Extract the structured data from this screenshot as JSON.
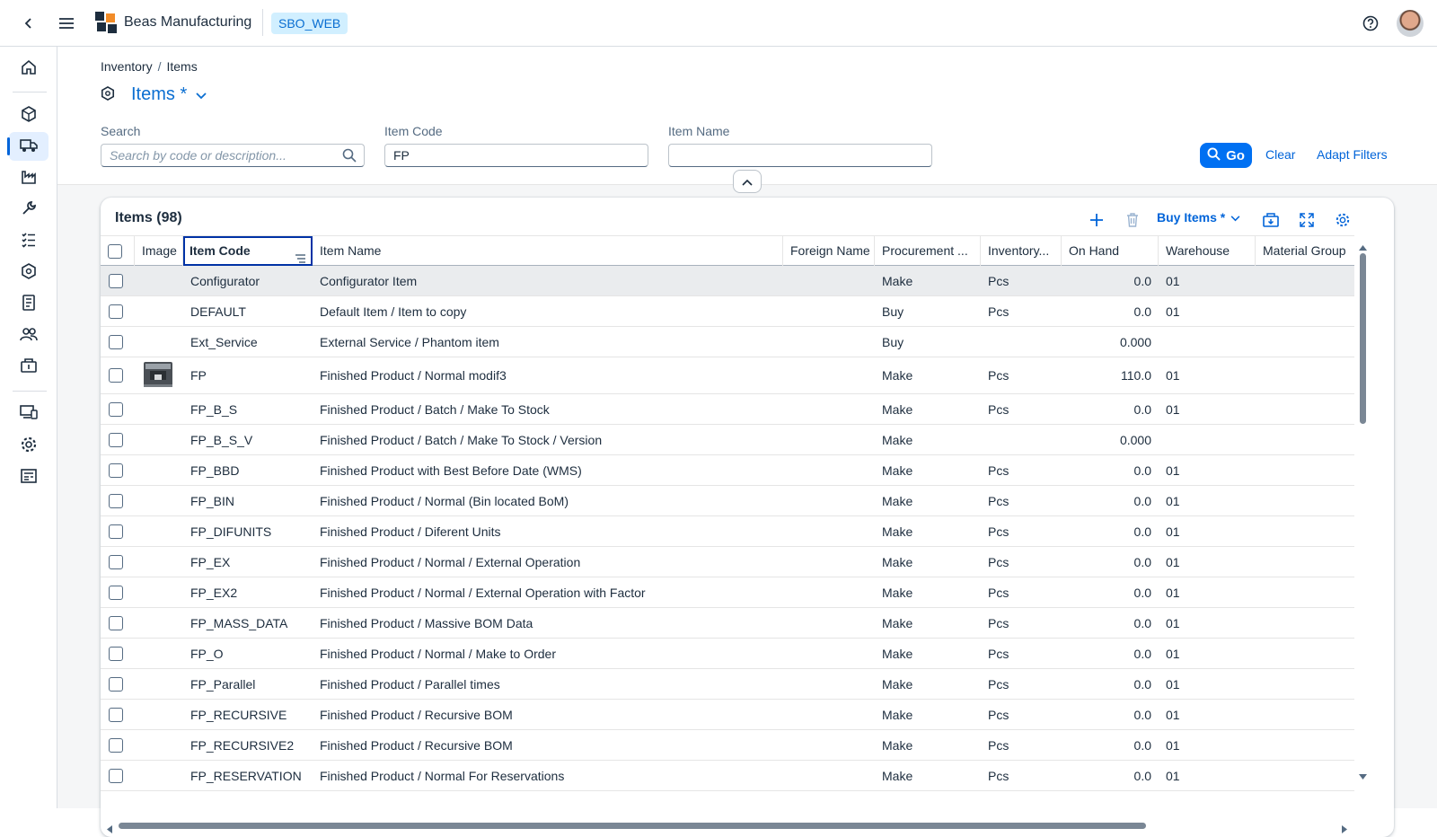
{
  "shell": {
    "app_name": "Beas Manufacturing",
    "system_tag": "SBO_WEB"
  },
  "breadcrumb": {
    "items": [
      "Inventory",
      "Items"
    ],
    "separator": "/"
  },
  "page": {
    "title": "Items *"
  },
  "filters": {
    "search": {
      "label": "Search",
      "value": "",
      "placeholder": "Search by code or description..."
    },
    "item_code": {
      "label": "Item Code",
      "value": "FP"
    },
    "item_name": {
      "label": "Item Name",
      "value": ""
    },
    "go_label": "Go",
    "clear_label": "Clear",
    "adapt_label": "Adapt Filters"
  },
  "table": {
    "title": "Items (98)",
    "variant": "Buy Items *",
    "columns": [
      "Image",
      "Item Code",
      "Item Name",
      "Foreign Name",
      "Procurement ...",
      "Inventory...",
      "On Hand",
      "Warehouse",
      "Material Group"
    ],
    "rows": [
      {
        "code": "Configurator",
        "name": "Configurator Item",
        "foreign": "",
        "proc": "Make",
        "inv": "Pcs",
        "onhand": "0.0",
        "wh": "01",
        "mg": "",
        "image": false
      },
      {
        "code": "DEFAULT",
        "name": "Default Item / Item to copy",
        "foreign": "",
        "proc": "Buy",
        "inv": "Pcs",
        "onhand": "0.0",
        "wh": "01",
        "mg": "",
        "image": false
      },
      {
        "code": "Ext_Service",
        "name": "External Service / Phantom item",
        "foreign": "",
        "proc": "Buy",
        "inv": "",
        "onhand": "0.000",
        "wh": "",
        "mg": "",
        "image": false
      },
      {
        "code": "FP",
        "name": "Finished Product / Normal modif3",
        "foreign": "",
        "proc": "Make",
        "inv": "Pcs",
        "onhand": "110.0",
        "wh": "01",
        "mg": "",
        "image": true
      },
      {
        "code": "FP_B_S",
        "name": "Finished Product / Batch / Make To Stock",
        "foreign": "",
        "proc": "Make",
        "inv": "Pcs",
        "onhand": "0.0",
        "wh": "01",
        "mg": "",
        "image": false
      },
      {
        "code": "FP_B_S_V",
        "name": "Finished Product / Batch / Make To Stock / Version",
        "foreign": "",
        "proc": "Make",
        "inv": "",
        "onhand": "0.000",
        "wh": "",
        "mg": "",
        "image": false
      },
      {
        "code": "FP_BBD",
        "name": "Finished Product with Best Before Date (WMS)",
        "foreign": "",
        "proc": "Make",
        "inv": "Pcs",
        "onhand": "0.0",
        "wh": "01",
        "mg": "",
        "image": false
      },
      {
        "code": "FP_BIN",
        "name": "Finished Product / Normal (Bin located BoM)",
        "foreign": "",
        "proc": "Make",
        "inv": "Pcs",
        "onhand": "0.0",
        "wh": "01",
        "mg": "",
        "image": false
      },
      {
        "code": "FP_DIFUNITS",
        "name": "Finished Product / Diferent Units",
        "foreign": "",
        "proc": "Make",
        "inv": "Pcs",
        "onhand": "0.0",
        "wh": "01",
        "mg": "",
        "image": false
      },
      {
        "code": "FP_EX",
        "name": "Finished Product / Normal / External Operation",
        "foreign": "",
        "proc": "Make",
        "inv": "Pcs",
        "onhand": "0.0",
        "wh": "01",
        "mg": "",
        "image": false
      },
      {
        "code": "FP_EX2",
        "name": "Finished Product / Normal / External Operation with Factor",
        "foreign": "",
        "proc": "Make",
        "inv": "Pcs",
        "onhand": "0.0",
        "wh": "01",
        "mg": "",
        "image": false
      },
      {
        "code": "FP_MASS_DATA",
        "name": "Finished Product / Massive BOM Data",
        "foreign": "",
        "proc": "Make",
        "inv": "Pcs",
        "onhand": "0.0",
        "wh": "01",
        "mg": "",
        "image": false
      },
      {
        "code": "FP_O",
        "name": "Finished Product / Normal / Make to Order",
        "foreign": "",
        "proc": "Make",
        "inv": "Pcs",
        "onhand": "0.0",
        "wh": "01",
        "mg": "",
        "image": false
      },
      {
        "code": "FP_Parallel",
        "name": "Finished Product / Parallel times",
        "foreign": "",
        "proc": "Make",
        "inv": "Pcs",
        "onhand": "0.0",
        "wh": "01",
        "mg": "",
        "image": false
      },
      {
        "code": "FP_RECURSIVE",
        "name": "Finished Product / Recursive BOM",
        "foreign": "",
        "proc": "Make",
        "inv": "Pcs",
        "onhand": "0.0",
        "wh": "01",
        "mg": "",
        "image": false
      },
      {
        "code": "FP_RECURSIVE2",
        "name": "Finished Product / Recursive BOM",
        "foreign": "",
        "proc": "Make",
        "inv": "Pcs",
        "onhand": "0.0",
        "wh": "01",
        "mg": "",
        "image": false
      },
      {
        "code": "FP_RESERVATION",
        "name": "Finished Product / Normal For Reservations",
        "foreign": "",
        "proc": "Make",
        "inv": "Pcs",
        "onhand": "0.0",
        "wh": "01",
        "mg": "",
        "image": false
      }
    ]
  },
  "icons": {
    "shell": [
      "back-icon",
      "menu-icon",
      "help-icon"
    ],
    "sidebar": [
      "home-icon",
      "cubes-icon",
      "delivery-truck-icon",
      "factory-icon",
      "wrench-icon",
      "task-list-icon",
      "product-icon",
      "document-icon",
      "people-icon",
      "money-box-icon",
      "devices-icon",
      "settings-icon",
      "report-icon"
    ],
    "toolbar": [
      "add-icon",
      "delete-icon",
      "export-icon",
      "fullscreen-icon",
      "settings-icon"
    ]
  },
  "colors": {
    "accent": "#0070f2",
    "link": "#0064d9",
    "tag_bg": "#d1efff",
    "selected_row": "#eaecee"
  }
}
